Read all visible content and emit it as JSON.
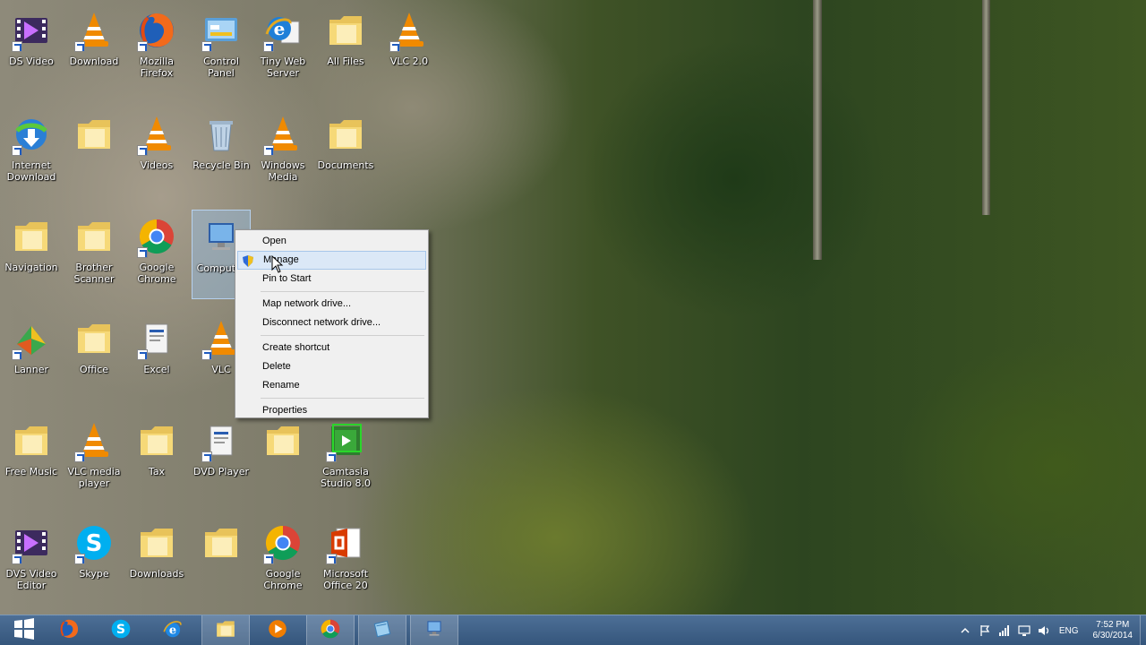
{
  "desktop_icons": [
    {
      "id": "c0r0",
      "label": "DS Video",
      "icon": "video-film-icon"
    },
    {
      "id": "c0r1",
      "label": "Internet Download",
      "icon": "idm-icon"
    },
    {
      "id": "c0r2",
      "label": "Navigation",
      "icon": "folder-icon"
    },
    {
      "id": "c0r3",
      "label": "Lanner",
      "icon": "app-cubes-icon"
    },
    {
      "id": "c0r4",
      "label": "Free Music",
      "icon": "folder-icon"
    },
    {
      "id": "c0r5",
      "label": "DVS Video Editor",
      "icon": "video-film-icon"
    },
    {
      "id": "c1r0",
      "label": "Download",
      "icon": "vlc-icon"
    },
    {
      "id": "c1r1",
      "label": "",
      "icon": "folder-icon"
    },
    {
      "id": "c1r2",
      "label": "Brother Scanner",
      "icon": "folder-icon"
    },
    {
      "id": "c1r3",
      "label": "Office",
      "icon": "folder-icon"
    },
    {
      "id": "c1r4",
      "label": "VLC media player",
      "icon": "vlc-icon"
    },
    {
      "id": "c1r5",
      "label": "Skype",
      "icon": "skype-icon"
    },
    {
      "id": "c2r0",
      "label": "Mozilla Firefox",
      "icon": "firefox-icon"
    },
    {
      "id": "c2r1",
      "label": "Videos",
      "icon": "vlc-icon"
    },
    {
      "id": "c2r2",
      "label": "Google Chrome",
      "icon": "chrome-icon"
    },
    {
      "id": "c2r3",
      "label": "Excel",
      "icon": "app-doc-icon"
    },
    {
      "id": "c2r4",
      "label": "Tax",
      "icon": "folder-icon"
    },
    {
      "id": "c2r5",
      "label": "Downloads",
      "icon": "folder-icon"
    },
    {
      "id": "c3r0",
      "label": "Control Panel",
      "icon": "control-panel-icon"
    },
    {
      "id": "c3r1",
      "label": "Recycle Bin",
      "icon": "recycle-bin-icon"
    },
    {
      "id": "c3r2",
      "label": "Computer",
      "icon": "computer-icon",
      "selected": true
    },
    {
      "id": "c3r3",
      "label": "VLC",
      "icon": "vlc-icon"
    },
    {
      "id": "c3r4",
      "label": "DVD Player",
      "icon": "app-doc-icon"
    },
    {
      "id": "c3r5",
      "label": "",
      "icon": "folder-icon"
    },
    {
      "id": "c4r0",
      "label": "Tiny Web Server",
      "icon": "ie-app-icon"
    },
    {
      "id": "c4r1",
      "label": "Windows Media",
      "icon": "vlc-icon"
    },
    {
      "id": "c4r4",
      "label": "",
      "icon": "folder-icon"
    },
    {
      "id": "c4r5",
      "label": "Google Chrome",
      "icon": "chrome-icon"
    },
    {
      "id": "c5r0",
      "label": "All Files",
      "icon": "folder-icon"
    },
    {
      "id": "c5r1",
      "label": "Documents",
      "icon": "folder-icon"
    },
    {
      "id": "c5r4",
      "label": "Camtasia Studio 8.0",
      "icon": "camtasia-icon"
    },
    {
      "id": "c5r5",
      "label": "Microsoft Office 20",
      "icon": "office-icon"
    },
    {
      "id": "c6r0",
      "label": "VLC 2.0",
      "icon": "vlc-icon"
    }
  ],
  "context_menu": {
    "items": [
      {
        "label": "Open",
        "type": "item"
      },
      {
        "label": "Manage",
        "type": "item",
        "highlighted": true,
        "shield": true
      },
      {
        "label": "Pin to Start",
        "type": "item"
      },
      {
        "type": "separator"
      },
      {
        "label": "Map network drive...",
        "type": "item"
      },
      {
        "label": "Disconnect network drive...",
        "type": "item"
      },
      {
        "type": "separator"
      },
      {
        "label": "Create shortcut",
        "type": "item"
      },
      {
        "label": "Delete",
        "type": "item"
      },
      {
        "label": "Rename",
        "type": "item"
      },
      {
        "type": "separator"
      },
      {
        "label": "Properties",
        "type": "item"
      }
    ]
  },
  "taskbar": {
    "items": [
      {
        "name": "start-button",
        "icon": "windows-logo-icon"
      },
      {
        "name": "taskbar-firefox",
        "icon": "firefox-icon"
      },
      {
        "name": "taskbar-skype",
        "icon": "skype-icon"
      },
      {
        "name": "taskbar-ie",
        "icon": "ie-icon"
      },
      {
        "name": "taskbar-file-explorer",
        "icon": "folder-icon",
        "active": true
      },
      {
        "name": "taskbar-media-player",
        "icon": "media-player-icon"
      },
      {
        "name": "taskbar-chrome",
        "icon": "chrome-icon",
        "active": true
      },
      {
        "name": "taskbar-app",
        "icon": "app-window-icon",
        "active": true
      },
      {
        "name": "taskbar-computer",
        "icon": "computer-icon",
        "active": true
      }
    ],
    "tray": {
      "language": "ENG",
      "time": "7:52 PM",
      "date": "6/30/2014"
    }
  },
  "colors": {
    "taskbar": "#3f6189",
    "menu_highlight": "#dbe8f7",
    "selection": "#96bee6",
    "highlight_box": "#2ad72a"
  }
}
